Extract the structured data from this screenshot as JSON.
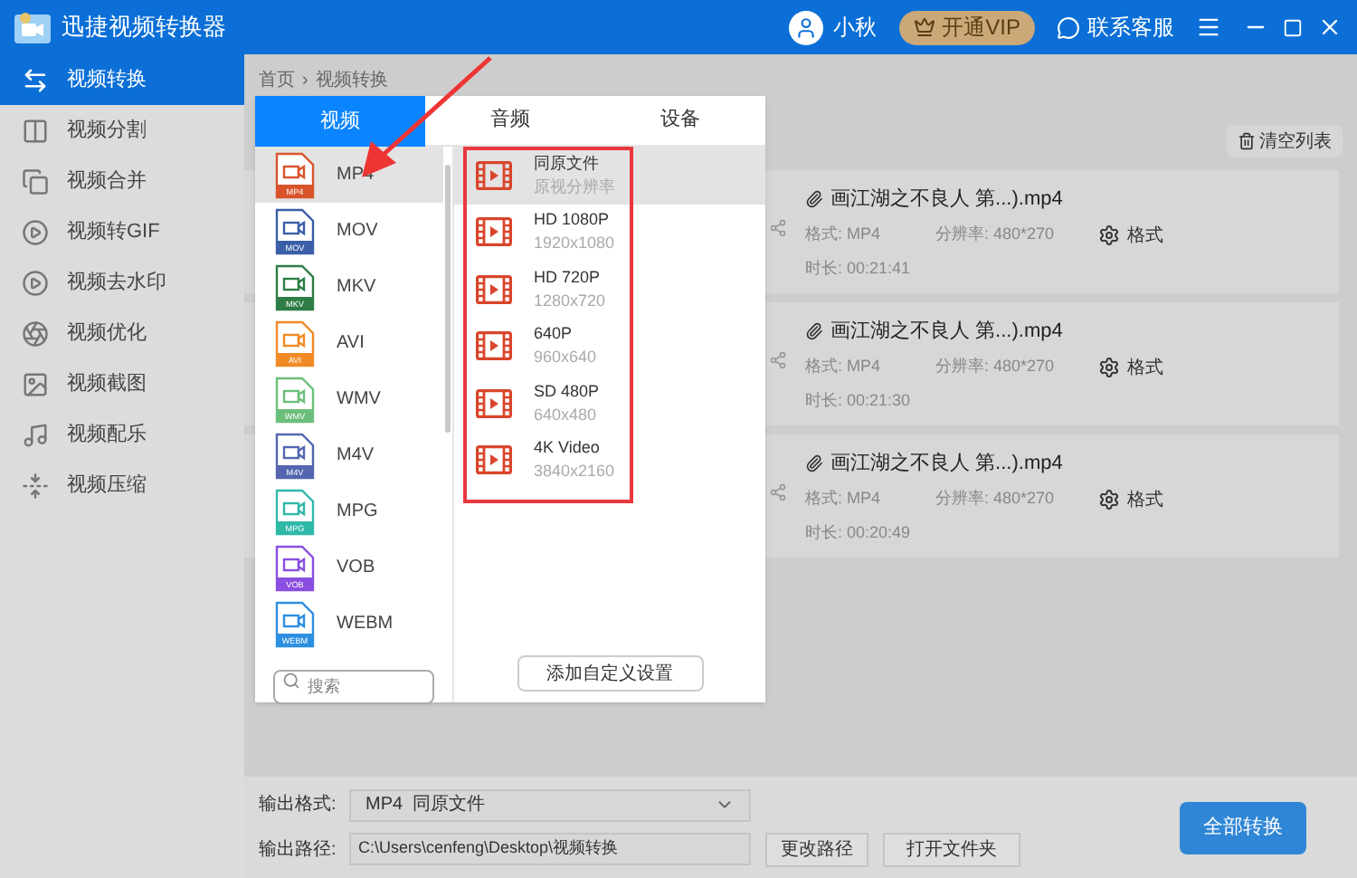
{
  "window": {
    "title": "迅捷视频转换器",
    "user": "小秋",
    "vip": "开通VIP",
    "support": "联系客服"
  },
  "sidebar": {
    "items": [
      {
        "label": "视频转换",
        "selected": true,
        "kind": "convert"
      },
      {
        "label": "视频分割",
        "selected": false,
        "kind": "split"
      },
      {
        "label": "视频合并",
        "selected": false,
        "kind": "merge"
      },
      {
        "label": "视频转GIF",
        "selected": false,
        "kind": "gif"
      },
      {
        "label": "视频去水印",
        "selected": false,
        "kind": "watermark"
      },
      {
        "label": "视频优化",
        "selected": false,
        "kind": "optimize"
      },
      {
        "label": "视频截图",
        "selected": false,
        "kind": "screenshot"
      },
      {
        "label": "视频配乐",
        "selected": false,
        "kind": "music"
      },
      {
        "label": "视频压缩",
        "selected": false,
        "kind": "compress"
      }
    ]
  },
  "breadcrumb": [
    "首页",
    "›",
    "视频转换"
  ],
  "popup": {
    "tabs": [
      {
        "label": "视频",
        "selected": true
      },
      {
        "label": "音频",
        "selected": false
      },
      {
        "label": "设备",
        "selected": false
      }
    ],
    "formats": [
      {
        "label": "MP4",
        "badge": "MP4",
        "color": "#d9542b",
        "selected": true
      },
      {
        "label": "MOV",
        "badge": "MOV",
        "color": "#3b5ea8",
        "selected": false
      },
      {
        "label": "MKV",
        "badge": "MKV",
        "color": "#2e7d46",
        "selected": false
      },
      {
        "label": "AVI",
        "badge": "AVI",
        "color": "#f08a24",
        "selected": false
      },
      {
        "label": "WMV",
        "badge": "WMV",
        "color": "#6cbf7a",
        "selected": false
      },
      {
        "label": "M4V",
        "badge": "M4V",
        "color": "#5566b0",
        "selected": false
      },
      {
        "label": "MPG",
        "badge": "MPG",
        "color": "#2fb8a8",
        "selected": false
      },
      {
        "label": "VOB",
        "badge": "VOB",
        "color": "#8a4fe0",
        "selected": false
      },
      {
        "label": "WEBM",
        "badge": "WEBM",
        "color": "#2d8fe0",
        "selected": false
      }
    ],
    "search": {
      "placeholder": "搜索"
    },
    "presets": [
      {
        "title": "同原文件",
        "subtitle": "原视分辨率",
        "selected": true
      },
      {
        "title": "HD 1080P",
        "subtitle": "1920x1080",
        "selected": false
      },
      {
        "title": "HD 720P",
        "subtitle": "1280x720",
        "selected": false
      },
      {
        "title": "640P",
        "subtitle": "960x640",
        "selected": false
      },
      {
        "title": "SD 480P",
        "subtitle": "640x480",
        "selected": false
      },
      {
        "title": "4K Video",
        "subtitle": "3840x2160",
        "selected": false
      }
    ],
    "custom_button": "添加自定义设置"
  },
  "toolbar": {
    "clear_button": "清空列表"
  },
  "files": [
    {
      "name": "画江湖之不良人 第...).mp4",
      "format": "格式:  MP4",
      "resolution": "分辨率: 480*270",
      "duration": "时长:  00:21:41",
      "settings": "格式"
    },
    {
      "name": "画江湖之不良人 第...).mp4",
      "format": "格式:  MP4",
      "resolution": "分辨率: 480*270",
      "duration": "时长:  00:21:30",
      "settings": "格式"
    },
    {
      "name": "画江湖之不良人 第...).mp4",
      "format": "格式:  MP4",
      "resolution": "分辨率: 480*270",
      "duration": "时长:  00:20:49",
      "settings": "格式"
    }
  ],
  "output": {
    "format_label": "输出格式:",
    "format_value": "MP4  同原文件",
    "path_label": "输出路径:",
    "path_value": "C:\\Users\\cenfeng\\Desktop\\视频转换",
    "change_path": "更改路径",
    "open_folder": "打开文件夹",
    "convert_all": "全部转换"
  }
}
